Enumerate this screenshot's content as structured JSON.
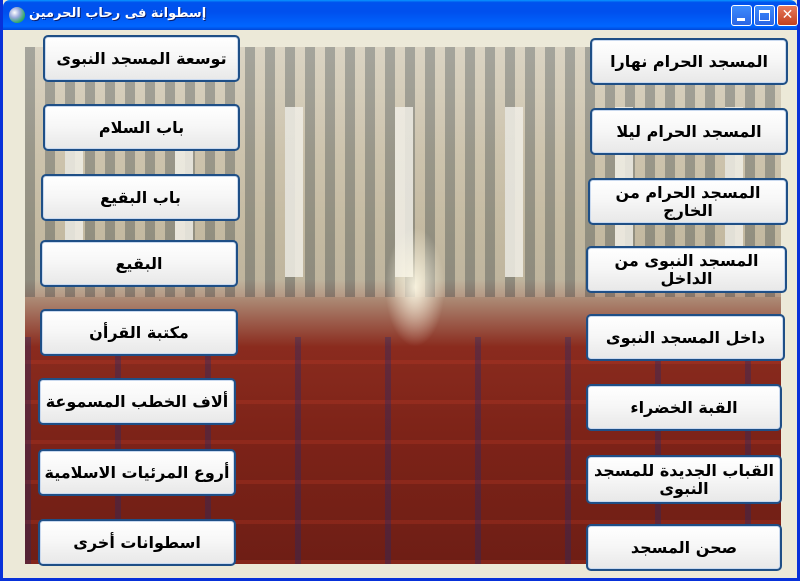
{
  "window": {
    "title": "إسطوانة فى رحاب الحرمين"
  },
  "buttons_right": [
    "المسجد الحرام نهارا",
    "المسجد الحرام ليلا",
    "المسجد الحرام من الخارج",
    "المسجد النبوى من الداخل",
    "داخل المسجد النبوى",
    "القبة الخضراء",
    "القباب الجديدة للمسجد النبوى",
    "صحن المسجد"
  ],
  "buttons_left": [
    "توسعة المسجد النبوى",
    "باب السلام",
    "باب البقيع",
    "البقيع",
    "مكتبة القرأن",
    "ألاف الخطب المسموعة",
    "أروع المرئيات الاسلامية",
    "اسطوانات أخرى"
  ]
}
